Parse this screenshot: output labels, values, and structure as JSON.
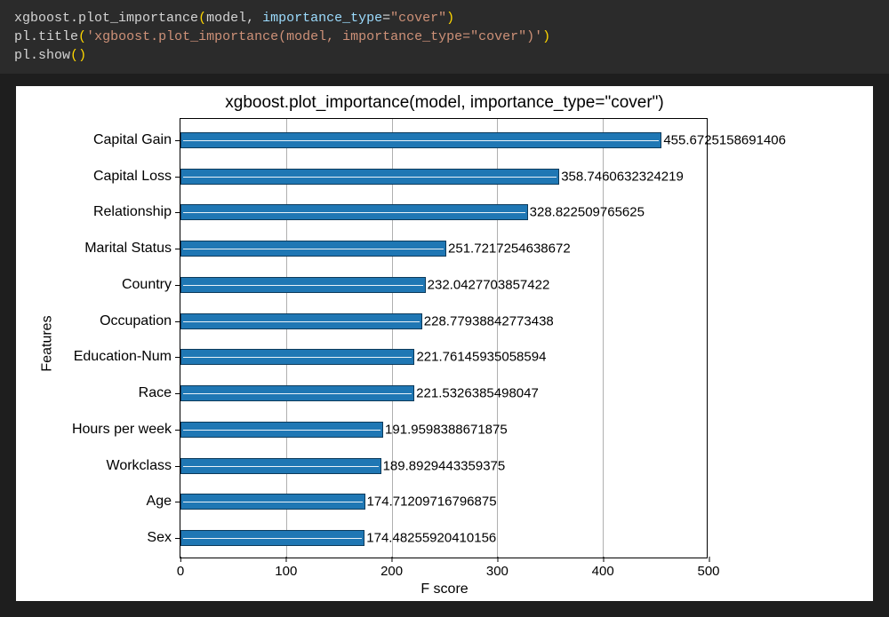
{
  "code": {
    "l1": {
      "mod": "xgboost",
      "dot": ".",
      "fn": "plot_importance",
      "po": "(",
      "arg1": "model",
      "comma": ", ",
      "kw": "importance_type",
      "eq": "=",
      "str": "\"cover\"",
      "pc": ")"
    },
    "l2": {
      "mod": "pl",
      "dot": ".",
      "fn": "title",
      "po": "(",
      "str": "'xgboost.plot_importance(model, importance_type=\"cover\")'",
      "pc": ")"
    },
    "l3": {
      "mod": "pl",
      "dot": ".",
      "fn": "show",
      "po": "(",
      "pc": ")"
    }
  },
  "chart_data": {
    "type": "bar",
    "orientation": "horizontal",
    "title": "xgboost.plot_importance(model, importance_type=\"cover\")",
    "xlabel": "F score",
    "ylabel": "Features",
    "xlim": [
      0,
      500
    ],
    "xticks": [
      0,
      100,
      200,
      300,
      400,
      500
    ],
    "categories": [
      "Capital Gain",
      "Capital Loss",
      "Relationship",
      "Marital Status",
      "Country",
      "Occupation",
      "Education-Num",
      "Race",
      "Hours per week",
      "Workclass",
      "Age",
      "Sex"
    ],
    "values": [
      455.6725158691406,
      358.7460632324219,
      328.822509765625,
      251.7217254638672,
      232.0427703857422,
      228.77938842773438,
      221.76145935058594,
      221.5326385498047,
      191.9598388671875,
      189.8929443359375,
      174.71209716796875,
      174.48255920410156
    ],
    "value_labels": [
      "455.6725158691406",
      "358.7460632324219",
      "328.822509765625",
      "251.7217254638672",
      "232.0427703857422",
      "228.77938842773438",
      "221.76145935058594",
      "221.5326385498047",
      "191.9598388671875",
      "189.8929443359375",
      "174.71209716796875",
      "174.48255920410156"
    ]
  }
}
